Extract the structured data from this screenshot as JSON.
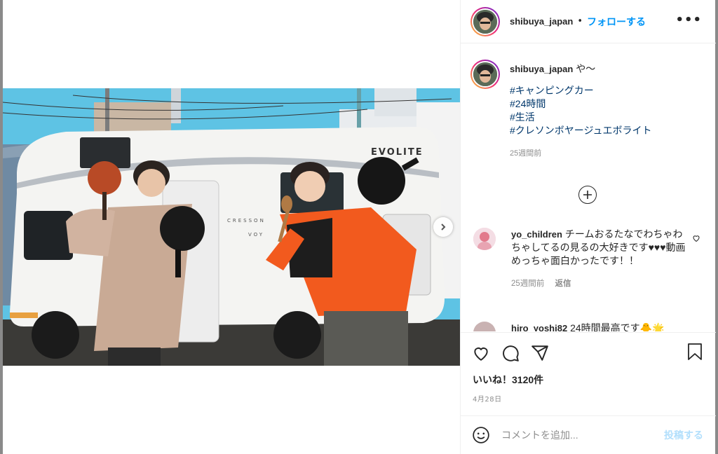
{
  "post": {
    "username": "shibuya_japan",
    "follow_label": "フォローする",
    "separator": "•",
    "more_label": "•••"
  },
  "caption": {
    "username": "shibuya_japan",
    "text": "や〜",
    "hashtags": [
      "#キャンピングカー",
      "#24時間",
      "#生活",
      "#クレソンボヤージュエボライト"
    ],
    "time": "25週間前"
  },
  "comments": [
    {
      "username": "yo_children",
      "text": "チームおるたなでわちゃわちゃしてるの見るの大好きです♥♥♥動画めっちゃ面白かったです！！",
      "time": "25週間前",
      "reply_label": "返信"
    },
    {
      "username": "hiro_yoshi82",
      "text": "24時間最高です🐥🌟"
    }
  ],
  "photo": {
    "van_brand": "EVOLITE",
    "van_side_text": "CRESSON",
    "van_side_text2": "VOY"
  },
  "likes_label": "いいね！3120件",
  "date_label": "4月28日",
  "comment_input": {
    "placeholder": "コメントを追加..."
  },
  "post_button_label": "投稿する",
  "colors": {
    "accent": "#0095f6",
    "post_disabled": "#b2dffc",
    "hashtag": "#00376b"
  }
}
